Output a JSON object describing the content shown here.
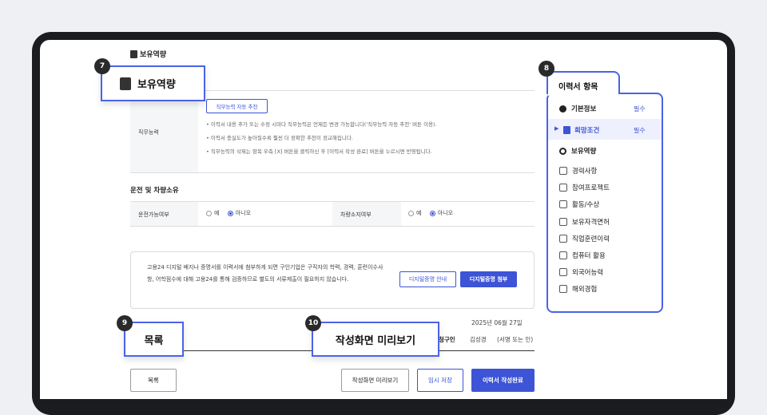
{
  "section_title": "보유역량",
  "job_skill": {
    "label": "직무능력",
    "recommend_button": "직무능력 자동 추천",
    "notes": [
      "이력서 내용 추가 또는 수정 시마다 직무능력은 언제든 변경 가능합니다('직무능력 자동 추천' 버튼 이용).",
      "이력서 충실도가 높아질수록 훨씬 더 정확한 추천이 정교해집니다.",
      "직무능력의 삭제는 항목 우측 [X] 버튼을 클릭하신 후 [이력서 작성 완료] 버튼을 누르시면 반영됩니다."
    ]
  },
  "driving": {
    "heading": "운전 및 차량소유",
    "license_label": "운전가능여부",
    "vehicle_label": "차량소지여부",
    "yes": "예",
    "no": "아니오"
  },
  "digital_badge": {
    "text": "고용24 디지털 배지나 증명서를 이력서에 첨부하게 되면 구인기업은 구직자의 학력, 경력, 훈련이수사항, 어학점수에 대해 고용24를 통해 검증하므로 별도의 서류제출이 필요하지 않습니다.",
    "guide_button": "디지털증명 안내",
    "attach_button": "디지털증명 첨부"
  },
  "signature": {
    "date": "2025년 06월 27일",
    "applicant_label": "청구인",
    "applicant_name": "김성경",
    "sign_hint": "(서명 또는 인)"
  },
  "footer": {
    "list_button": "목록",
    "preview_button": "작성화면 미리보기",
    "temp_save_button": "임시 저장",
    "complete_button": "이력서 작성완료"
  },
  "callouts": {
    "c7": {
      "num": "7",
      "label": "보유역량"
    },
    "c8": {
      "num": "8"
    },
    "c9": {
      "num": "9",
      "label": "목록"
    },
    "c10": {
      "num": "10",
      "label": "작성화면 미리보기"
    }
  },
  "resume_panel": {
    "title": "이력서 항목",
    "required_label": "필수",
    "basic": "기본정보",
    "hope": "희망조건",
    "skills": "보유역량",
    "items": [
      "경력사항",
      "참여프로젝트",
      "활동/수상",
      "보유자격면허",
      "직업훈련이력",
      "컴퓨터 활용",
      "외국어능력",
      "해외경험"
    ]
  },
  "colors": {
    "accent": "#3d54d6",
    "callout_border": "#4a63e6"
  }
}
